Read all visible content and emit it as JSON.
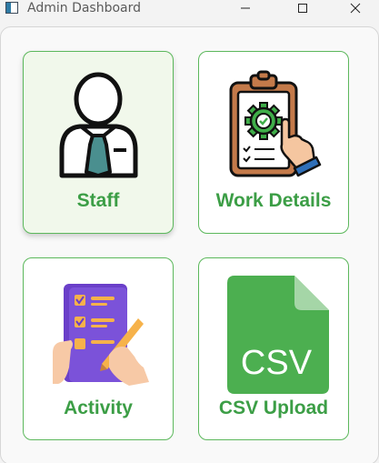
{
  "window": {
    "title": "Admin Dashboard",
    "controls": {
      "minimize": "minimize",
      "maximize": "maximize",
      "close": "close"
    }
  },
  "dashboard": {
    "tiles": [
      {
        "label": "Staff",
        "icon": "staff-person-icon",
        "state": "hover"
      },
      {
        "label": "Work Details",
        "icon": "clipboard-gear-icon"
      },
      {
        "label": "Activity",
        "icon": "checklist-pen-icon"
      },
      {
        "label": "CSV Upload",
        "icon": "csv-file-icon",
        "icon_text": "CSV"
      }
    ]
  },
  "colors": {
    "accent_green": "#3c9e46",
    "border_green": "#5cb85c",
    "hover_bg": "#f1f8eb",
    "csv_green": "#4caf50"
  }
}
